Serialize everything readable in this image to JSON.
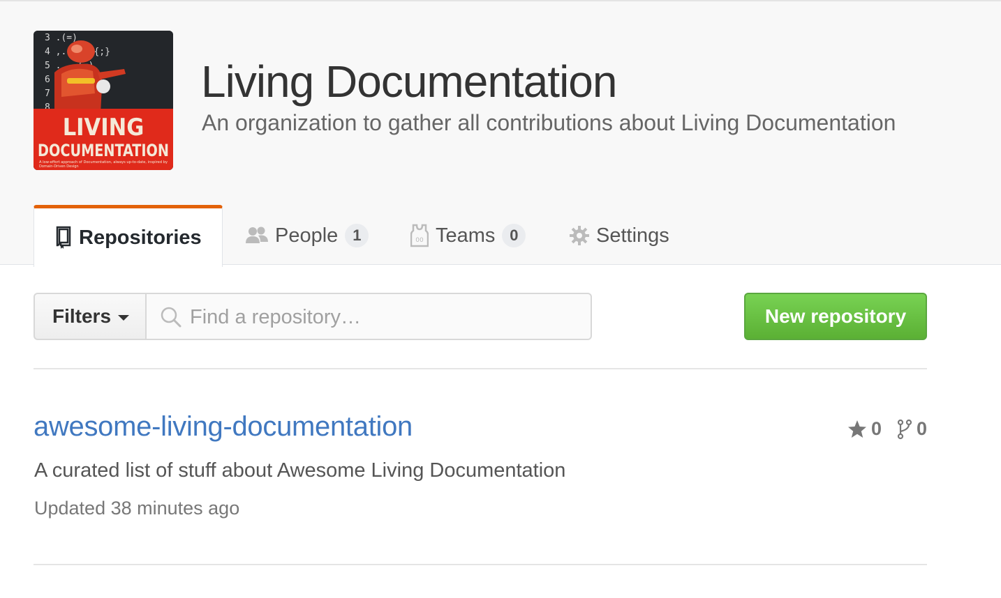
{
  "org": {
    "name": "Living Documentation",
    "description": "An organization to gather all contributions about Living Documentation",
    "avatar": {
      "title_line1": "LIVING",
      "title_line2": "DOCUMENTATION",
      "subtitle_line1": "A low-effort approach of Documentation, always up-to-date, inspired by",
      "subtitle_line2": "Domain-Driven Design",
      "code_lines": [
        "3  .(=)",
        "4  ,.){;;;{;}",
        "5  ....(=)",
        "6",
        "7",
        "8"
      ],
      "colors": {
        "red": "#e02a1b",
        "dark": "#23262a"
      }
    }
  },
  "tabs": [
    {
      "label": "Repositories",
      "icon": "repo-icon",
      "selected": true
    },
    {
      "label": "People",
      "icon": "people-icon",
      "count": "1"
    },
    {
      "label": "Teams",
      "icon": "jersey-icon",
      "count": "0"
    },
    {
      "label": "Settings",
      "icon": "gear-icon"
    }
  ],
  "toolbar": {
    "filters_label": "Filters",
    "search_placeholder": "Find a repository…",
    "search_value": "",
    "new_repo_label": "New repository"
  },
  "repositories": [
    {
      "name": "awesome-living-documentation",
      "description": "A curated list of stuff about Awesome Living Documentation",
      "updated": "Updated 38 minutes ago",
      "stars": "0",
      "forks": "0"
    }
  ],
  "colors": {
    "accent_tab": "#e36209",
    "link": "#4078c0",
    "primary_button": "#5bb034"
  }
}
